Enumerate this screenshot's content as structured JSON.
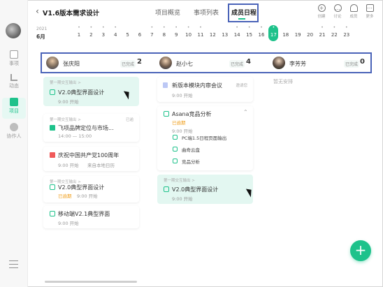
{
  "project_title": "V1.6版本需求设计",
  "tabs": [
    {
      "label": "项目概览"
    },
    {
      "label": "事项列表"
    },
    {
      "label": "成员日程"
    }
  ],
  "header_buttons": [
    {
      "label": "创建",
      "icon": "plus-circle-icon"
    },
    {
      "label": "讨论",
      "icon": "chat-icon"
    },
    {
      "label": "成员",
      "icon": "members-icon"
    },
    {
      "label": "更多",
      "icon": "more-icon"
    }
  ],
  "sidebar": {
    "items": [
      {
        "label": "事项",
        "icon": "calendar-check-icon"
      },
      {
        "label": "动态",
        "icon": "activity-icon"
      },
      {
        "label": "项目",
        "icon": "project-icon"
      },
      {
        "label": "协作人",
        "icon": "collaborator-icon"
      }
    ]
  },
  "dates": {
    "year": "2021",
    "month": "6月",
    "days": [
      {
        "dot": "•",
        "num": "1"
      },
      {
        "dot": "•",
        "num": "2"
      },
      {
        "dot": "•",
        "num": "3"
      },
      {
        "dot": "•",
        "num": "4"
      },
      {
        "dot": "",
        "num": "5"
      },
      {
        "dot": "",
        "num": "6"
      },
      {
        "dot": "•",
        "num": "7"
      },
      {
        "dot": "•",
        "num": "8"
      },
      {
        "dot": "•",
        "num": "9"
      },
      {
        "dot": "•",
        "num": "10"
      },
      {
        "dot": "•",
        "num": "11"
      },
      {
        "dot": "",
        "num": "12"
      },
      {
        "dot": "",
        "num": "13"
      },
      {
        "dot": "•",
        "num": "14"
      },
      {
        "dot": "•",
        "num": "15"
      },
      {
        "dot": "•",
        "num": "16"
      },
      {
        "dot": "•",
        "num": "17"
      },
      {
        "dot": "",
        "num": "18"
      },
      {
        "dot": "",
        "num": "19"
      },
      {
        "dot": "",
        "num": "20"
      },
      {
        "dot": "•",
        "num": "21"
      },
      {
        "dot": "•",
        "num": "22"
      },
      {
        "dot": "•",
        "num": "23"
      }
    ],
    "today_index": 16
  },
  "members": [
    {
      "name": "张庆阳",
      "done_label": "已完成",
      "done_count": "2"
    },
    {
      "name": "赵小七",
      "done_label": "已完成",
      "done_count": "4"
    },
    {
      "name": "李芳芳",
      "done_label": "已完成",
      "done_count": "0"
    }
  ],
  "col1": [
    {
      "parent": "第一期交互输出 >",
      "title": "V2.0典型界面设计",
      "time": "9:00 开始",
      "overdue": "",
      "source": ""
    },
    {
      "parent": "第一期交互输出 >",
      "title": "飞项品牌定位与市场...",
      "time": "14:00 — 15:00",
      "overdue": "",
      "source": "已逾"
    },
    {
      "parent": "",
      "title": "庆祝中国共产党100周年",
      "time": "9:00 开始",
      "overdue": "",
      "source": "来自本地日历"
    },
    {
      "parent": "第一期交互输出 >",
      "title": "V2.0典型界面设计",
      "time": "9:00 开始",
      "overdue": "已逾期",
      "source": ""
    },
    {
      "parent": "",
      "title": "移动端V2.1典型界面",
      "time": "9:00 开始",
      "overdue": "",
      "source": ""
    }
  ],
  "col2": {
    "card1": {
      "title": "新版本模块内审会议",
      "time": "9:00 开始",
      "source": "邀请您"
    },
    "card2": {
      "title": "Asana竞品分析",
      "overdue": "已逾期",
      "time": "9:00 开始",
      "subtasks": [
        "PC端1.5日程页面输出",
        "曲奇云盘",
        "竞品分析"
      ]
    },
    "card3": {
      "parent": "第一期交互输出 >",
      "title": "V2.0典型界面设计",
      "time": "9:00 开始"
    }
  },
  "col3": {
    "empty": "暂无安排"
  },
  "fab_label": "+",
  "colors": {
    "accent": "#1ec28b",
    "highlight_box": "#4a63b8",
    "overdue": "#f0a020"
  }
}
